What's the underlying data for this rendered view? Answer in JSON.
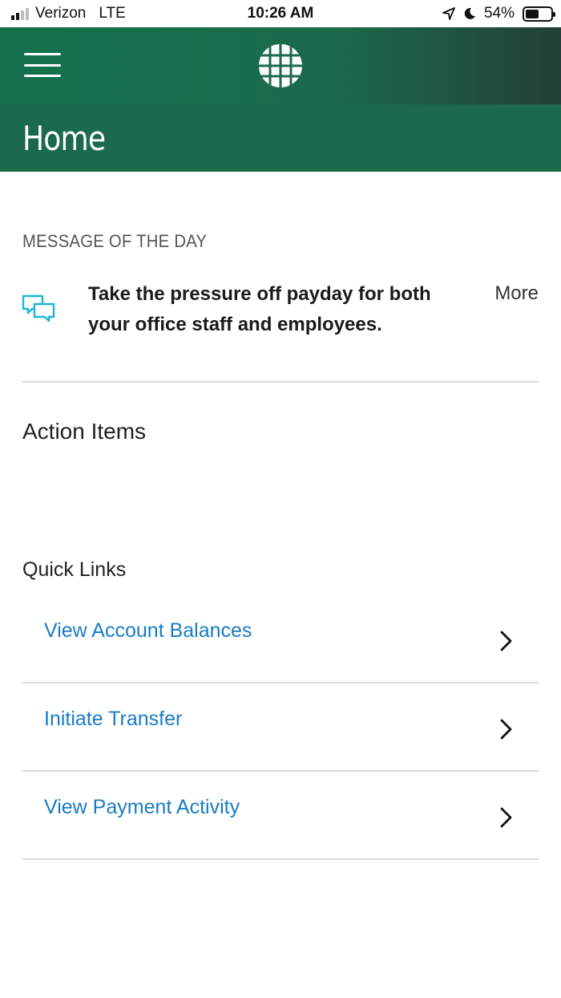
{
  "status_bar": {
    "carrier": "Verizon",
    "network": "LTE",
    "time": "10:26 AM",
    "battery": "54%",
    "battery_level": 0.54
  },
  "header": {
    "menu_icon": "hamburger-menu-icon",
    "logo_icon": "grid-globe-logo-icon",
    "page_title": "Home"
  },
  "message_of_the_day": {
    "label": "MESSAGE OF THE DAY",
    "icon": "chat-bubbles-icon",
    "text": "Take the pressure off payday for both your office staff and employees.",
    "more_label": "More"
  },
  "action_items": {
    "title": "Action Items"
  },
  "quick_links": {
    "title": "Quick Links",
    "items": [
      {
        "label": "View Account Balances"
      },
      {
        "label": "Initiate Transfer"
      },
      {
        "label": "View Payment Activity"
      }
    ]
  },
  "colors": {
    "header_green": "#1b6a4b",
    "link_blue": "#1a7cc4",
    "icon_cyan": "#1fb6d6"
  }
}
